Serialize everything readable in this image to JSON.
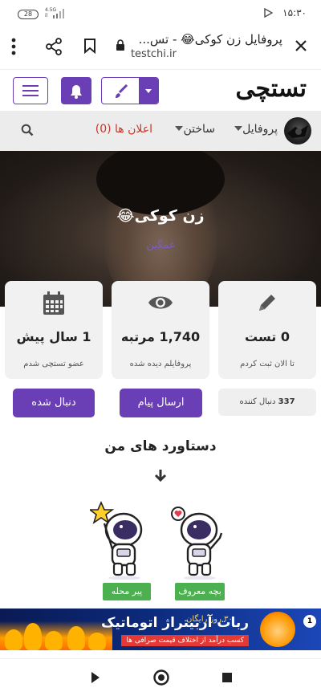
{
  "status_bar": {
    "time": "۱۵:۳۰",
    "battery": "28",
    "network": "4.5G",
    "network_sub": "il"
  },
  "browser": {
    "page_title": "پروفایل زن کوکی😂 - تس...",
    "domain": "testchi.ir"
  },
  "site": {
    "logo": "تستچی",
    "nav": [
      {
        "label": "پروفایل",
        "has_caret": true
      },
      {
        "label": "ساختن",
        "has_caret": true
      },
      {
        "label": "اعلان ها (0)",
        "has_caret": false
      }
    ]
  },
  "profile": {
    "name": "زن کوکی😂",
    "mood": "غمگین"
  },
  "stats": [
    {
      "icon": "pencil-icon",
      "value": "0 تست",
      "label": "تا الان ثبت کردم"
    },
    {
      "icon": "eye-icon",
      "value": "1,740 مرتبه",
      "label": "پروفایلم دیده شده"
    },
    {
      "icon": "calendar-icon",
      "value": "1 سال پیش",
      "label": "عضو تستچی شدم"
    }
  ],
  "actions": {
    "followers_count": "337",
    "followers_label": "دنبال کننده",
    "message_button": "ارسال پیام",
    "follow_button": "دنبال شده"
  },
  "achievements": {
    "title": "دستاورد های من",
    "items": [
      {
        "label": "بچه معروف"
      },
      {
        "label": "پیر محله"
      }
    ]
  },
  "ad": {
    "headline": "ربات آربیتراژ اتوماتیک",
    "tagline": "کسب درآمد از اختلاف قیمت صرافی ها",
    "free_days": "۳۰ روز رایگان",
    "badge": "1"
  },
  "colors": {
    "accent": "#6a3fb5",
    "badge_green": "#4caf50",
    "alert_red": "#c0392b"
  }
}
